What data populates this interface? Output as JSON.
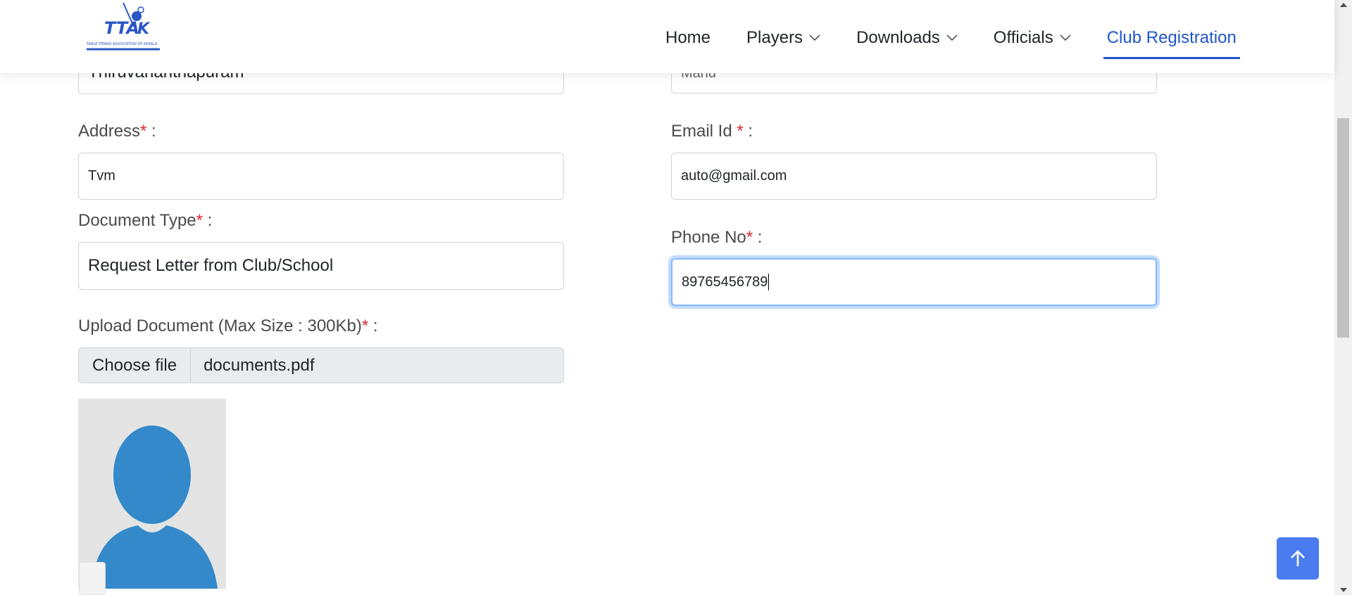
{
  "brand": {
    "logo_text": "TTAK",
    "logo_subtitle": "TABLE TENNIS ASSOCIATION OF KERALA"
  },
  "nav": {
    "items": [
      {
        "label": "Home",
        "has_dropdown": false
      },
      {
        "label": "Players",
        "has_dropdown": true
      },
      {
        "label": "Downloads",
        "has_dropdown": true
      },
      {
        "label": "Officials",
        "has_dropdown": true
      },
      {
        "label": "Club Registration",
        "has_dropdown": false,
        "active": true
      }
    ]
  },
  "form": {
    "district_value": "Thiruvananthapuram",
    "name_value": "Manu",
    "address": {
      "label": "Address",
      "req": "*",
      "sep": " :",
      "value": "Tvm"
    },
    "email": {
      "label": "Email Id ",
      "req": "*",
      "sep": " :",
      "value": "auto@gmail.com"
    },
    "document_type": {
      "label": "Document Type",
      "req": "*",
      "sep": " :",
      "value": "Request Letter from Club/School"
    },
    "phone": {
      "label": "Phone No",
      "req": "*",
      "sep": " :",
      "value": "89765456789"
    },
    "upload": {
      "label": "Upload Document (Max Size : 300Kb)",
      "req": "*",
      "sep": " :",
      "button": "Choose file",
      "file_name": "documents.pdf"
    }
  },
  "colors": {
    "accent": "#1f56c9",
    "required": "#e0262d",
    "avatar": "#3389c9",
    "scroll_top_button": "#4a7cf0"
  },
  "icons": {
    "dropdown": "chevron-down-icon",
    "scroll_top": "arrow-up-icon",
    "avatar": "user-placeholder-icon"
  }
}
